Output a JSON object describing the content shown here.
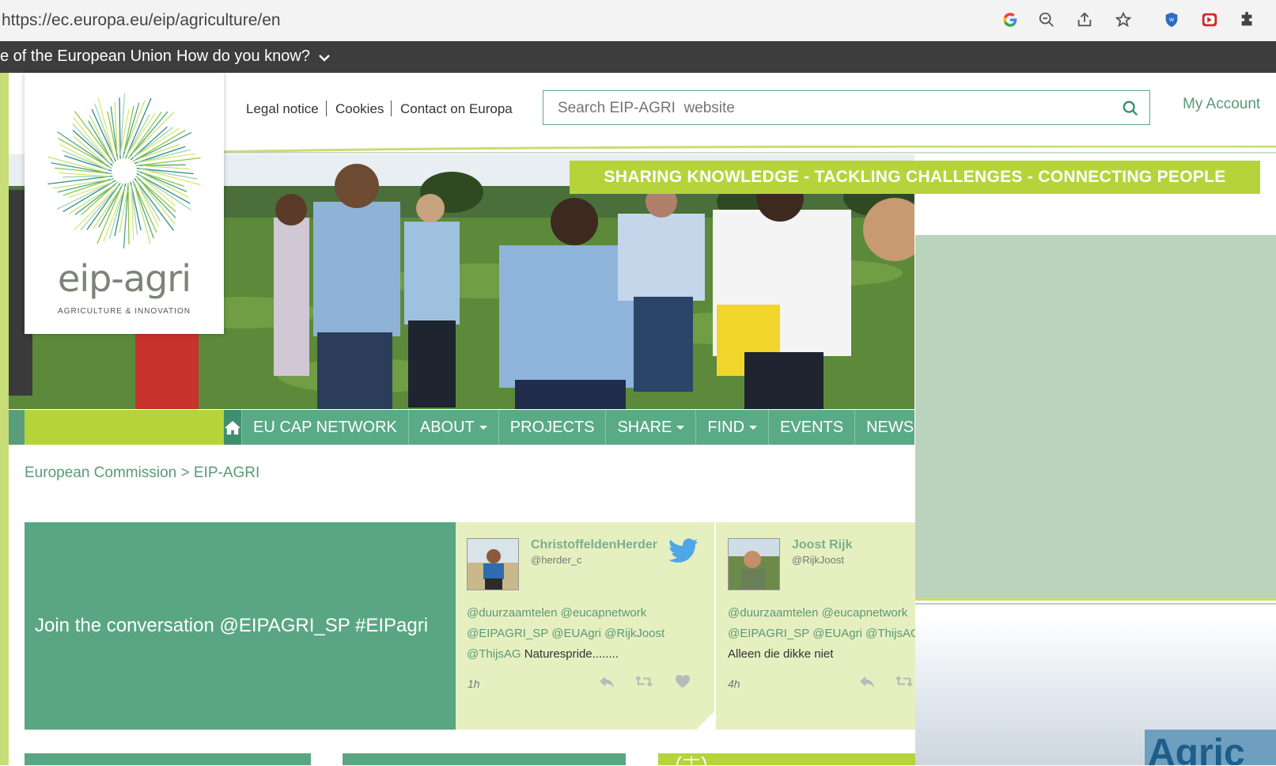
{
  "browser": {
    "url": "https://ec.europa.eu/eip/agriculture/en",
    "icons": [
      "google-icon",
      "zoom-out-icon",
      "share-icon",
      "star-icon",
      "shield-extension-icon",
      "media-extension-icon",
      "puzzle-extensions-icon"
    ]
  },
  "eu_strip": {
    "site_of_eu": "e of the European Union",
    "how_know": "How do you know?"
  },
  "header": {
    "links": [
      "Legal notice",
      "Cookies",
      "Contact on Europa"
    ],
    "search_placeholder": "Search EIP-AGRI  website",
    "my_account": "My Account"
  },
  "logo": {
    "word": "eip-agri",
    "sub": "AGRICULTURE & INNOVATION"
  },
  "hero": {
    "tagline": "SHARING KNOWLEDGE - TACKLING CHALLENGES - CONNECTING PEOPLE"
  },
  "nav": {
    "items": [
      {
        "label": "EU CAP NETWORK",
        "dropdown": false
      },
      {
        "label": "ABOUT",
        "dropdown": true
      },
      {
        "label": "PROJECTS",
        "dropdown": false
      },
      {
        "label": "SHARE",
        "dropdown": true
      },
      {
        "label": "FIND",
        "dropdown": true
      },
      {
        "label": "EVENTS",
        "dropdown": false
      },
      {
        "label": "NEWS",
        "dropdown": false
      }
    ]
  },
  "breadcrumb": {
    "root": "European Commission",
    "sep": ">",
    "current": "EIP-AGRI"
  },
  "social": {
    "join": "Join the conversation @EIPAGRI_SP #EIPagri",
    "tweets": [
      {
        "name": "ChristoffeldenHerder",
        "handle": "@herder_c",
        "line1": "@duurzaamtelen @eucapnetwork",
        "line2": "@EIPAGRI_SP @EUAgri @RijkJoost",
        "line3_mention": "@ThijsAG",
        "line3_text": " Naturespride........",
        "time": "1h"
      },
      {
        "name": "Joost Rijk",
        "handle": "@RijkJoost",
        "line1": "@duurzaamtelen @eucapnetwork",
        "line2": "@EIPAGRI_SP @EUAgri @ThijsAG",
        "line3_text": "Alleen die dikke niet",
        "time": "4h"
      }
    ]
  },
  "overlay": {
    "agri_text": "Agric"
  },
  "colors": {
    "eip_green": "#5aa683",
    "lime": "#b7d33c",
    "tweet_bg": "#e6efbf",
    "dark_strip": "#3d3d3d",
    "overlay": "#b9d3bc"
  }
}
